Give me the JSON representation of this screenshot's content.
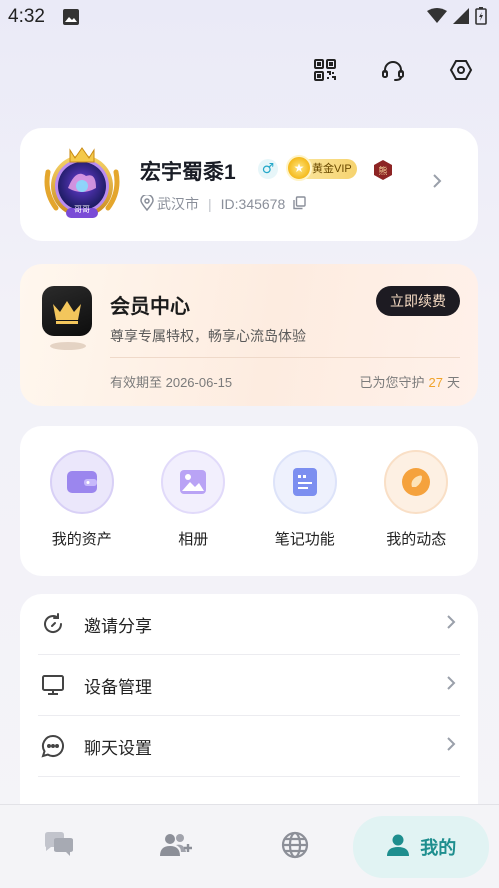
{
  "status_bar": {
    "time": "4:32"
  },
  "colors": {
    "accent": "#1e8e8e",
    "vip_gold": "#f6d36f",
    "days_highlight": "#f0a32a"
  },
  "top_actions": [
    {
      "icon": "qr-code-icon"
    },
    {
      "icon": "headset-icon"
    },
    {
      "icon": "settings-hexagon-icon"
    }
  ],
  "profile": {
    "name": "宏宇蜀黍1",
    "gender_symbol": "♂",
    "vip_badge": "黄金VIP",
    "rank_badge": "熊",
    "avatar_frame_text": "哥哥",
    "location": "武汉市",
    "id_text": "ID:345678"
  },
  "member": {
    "title": "会员中心",
    "renew_label": "立即续费",
    "description": "尊享专属特权，畅享心流岛体验",
    "expiry": "有效期至 2026-06-15",
    "guard_prefix": "已为您守护",
    "guard_days": "27",
    "guard_suffix": "天"
  },
  "quick_grid": [
    {
      "label": "我的资产",
      "icon": "wallet-icon"
    },
    {
      "label": "相册",
      "icon": "photo-album-icon"
    },
    {
      "label": "笔记功能",
      "icon": "note-icon"
    },
    {
      "label": "我的动态",
      "icon": "moments-icon"
    }
  ],
  "menu": [
    {
      "label": "邀请分享",
      "icon": "share-refresh-icon"
    },
    {
      "label": "设备管理",
      "icon": "monitor-icon"
    },
    {
      "label": "聊天设置",
      "icon": "chat-bubble-icon"
    }
  ],
  "bottom_nav": [
    {
      "icon": "chat-icon"
    },
    {
      "icon": "add-friend-icon"
    },
    {
      "icon": "globe-icon"
    },
    {
      "icon": "person-icon",
      "label": "我的",
      "active": true
    }
  ]
}
